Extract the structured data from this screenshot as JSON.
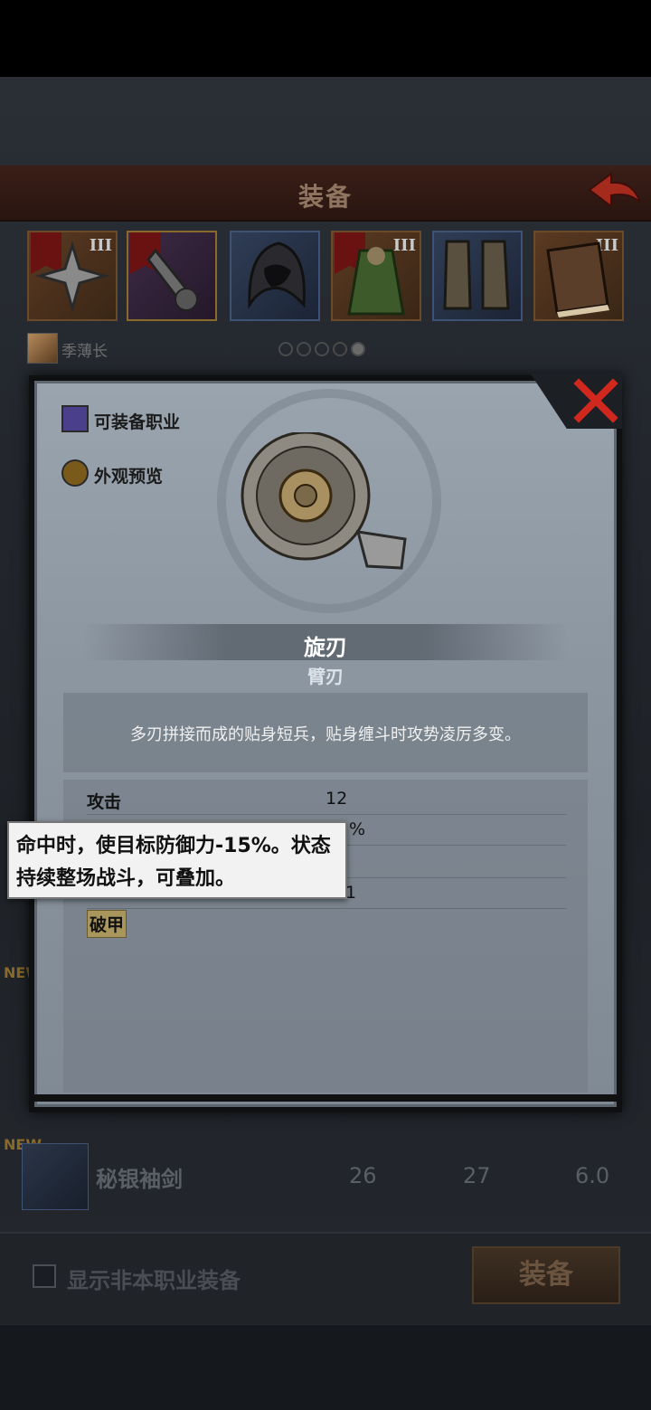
{
  "header": {
    "title": "装备"
  },
  "slots": [
    {
      "tier": "III",
      "name": "cross-star-weapon"
    },
    {
      "tier": "",
      "name": "arm-blade-weapon"
    },
    {
      "tier": "",
      "name": "hood-armor"
    },
    {
      "tier": "III",
      "name": "green-robe-armor"
    },
    {
      "tier": "",
      "name": "boots"
    },
    {
      "tier": "III",
      "name": "book"
    }
  ],
  "character": {
    "name": "季薄长"
  },
  "page_dots": {
    "count": 5,
    "active": 4
  },
  "background_list": {
    "new_tag": "NEW",
    "row": {
      "name": "秘银袖剑",
      "v1": "26",
      "v2": "27",
      "v3": "6.0"
    }
  },
  "bottom": {
    "checkbox_label": "显示非本职业装备",
    "equip_button": "装备"
  },
  "modal": {
    "job_button": "可装备职业",
    "preview_button": "外观预览",
    "item_name": "旋刃",
    "item_type": "臂刃",
    "item_desc": "多刃拼接而成的贴身短兵，贴身缠斗时攻势凌厉多变。",
    "stats": [
      {
        "label": "攻击",
        "value": "12"
      },
      {
        "label": "",
        "value": "%"
      },
      {
        "label": "",
        "value": ""
      },
      {
        "label": "",
        "value": "1"
      }
    ],
    "perk": "破甲",
    "tooltip": "命中时，使目标防御力-15%。状态持续整场战斗，可叠加。"
  },
  "colors": {
    "header": "#2a1510",
    "modal": "#8c96a0",
    "close": "#d0281e"
  }
}
